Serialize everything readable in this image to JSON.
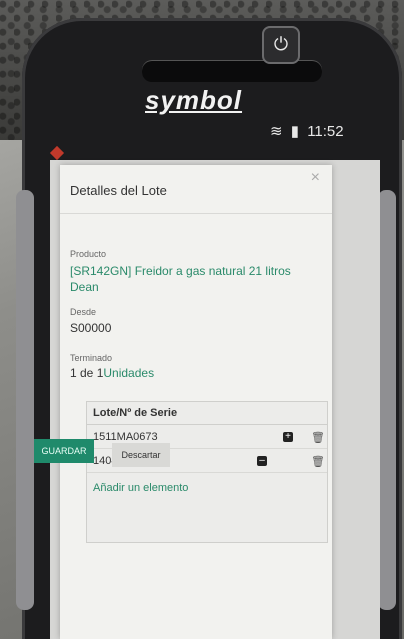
{
  "device": {
    "brand": "symbol",
    "status_time": "11:52"
  },
  "modal": {
    "title": "Detalles del Lote",
    "close_glyph": "×",
    "producto_label": "Producto",
    "producto_value": "[SR142GN] Freidor a gas natural 21 litros Dean",
    "desde_label": "Desde",
    "desde_value": "S00000",
    "terminado_label": "Terminado",
    "terminado_value": "1 de 1",
    "terminado_unit": "Unidades"
  },
  "table": {
    "header": "Lote/Nº de Serie",
    "rows": [
      {
        "lote": "1511MA0673"
      },
      {
        "lote": "1404MA0291"
      }
    ],
    "add_label": "Añadir un elemento"
  },
  "buttons": {
    "save": "GUARDAR",
    "discard": "Descartar"
  },
  "colors": {
    "accent": "#2a8a6a",
    "save_button": "#1f8a6b"
  }
}
